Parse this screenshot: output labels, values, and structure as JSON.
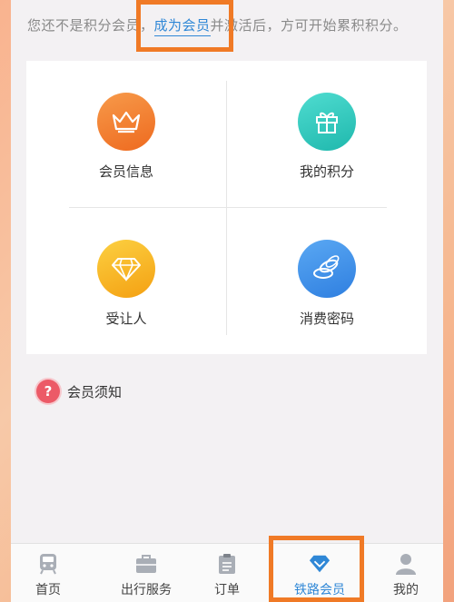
{
  "notice": {
    "before": "您还不是积分会员，",
    "link": "成为会员",
    "after": "并激活后，方可开始累积积分。"
  },
  "grid": [
    {
      "label": "会员信息",
      "icon": "crown-icon",
      "color": "#f07c2b"
    },
    {
      "label": "我的积分",
      "icon": "gift-icon",
      "color": "#33c9be"
    },
    {
      "label": "受让人",
      "icon": "diamond-icon",
      "color": "#f6b01d"
    },
    {
      "label": "消费密码",
      "icon": "coins-icon",
      "color": "#3d8ee8"
    }
  ],
  "member_notice": {
    "label": "会员须知"
  },
  "tabs": [
    {
      "label": "首页",
      "icon": "train-icon"
    },
    {
      "label": "出行服务",
      "icon": "briefcase-icon"
    },
    {
      "label": "订单",
      "icon": "clipboard-icon"
    },
    {
      "label": "铁路会员",
      "icon": "diamond-icon",
      "active": true
    },
    {
      "label": "我的",
      "icon": "person-icon"
    }
  ],
  "colors": {
    "accent": "#2f87d6",
    "highlight": "#f07a26"
  }
}
